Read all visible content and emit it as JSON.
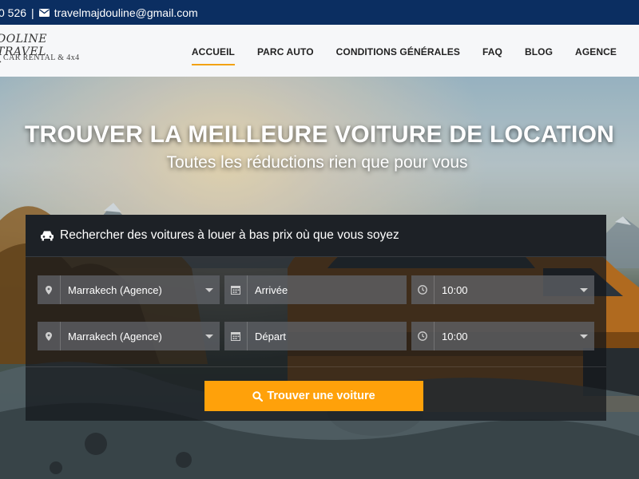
{
  "topbar": {
    "phone": "0 526",
    "separator": "|",
    "email": "travelmajdouline@gmail.com"
  },
  "logo": {
    "line1": "DOLINE TRAVEL",
    "line2": "CAR RENTAL & 4x4"
  },
  "nav": {
    "items": [
      {
        "label": "ACCUEIL",
        "active": true
      },
      {
        "label": "PARC AUTO"
      },
      {
        "label": "CONDITIONS GÉNÉRALES"
      },
      {
        "label": "FAQ"
      },
      {
        "label": "BLOG"
      },
      {
        "label": "AGENCE"
      }
    ]
  },
  "hero": {
    "title": "TROUVER LA MEILLEURE VOITURE DE LOCATION",
    "subtitle": "Toutes les réductions rien que pour vous"
  },
  "search": {
    "heading": "Rechercher des voitures à louer à bas prix où que vous soyez",
    "pickup_location": "Marrakech (Agence)",
    "pickup_date": "Arrivée",
    "pickup_time": "10:00",
    "return_location": "Marrakech (Agence)",
    "return_date": "Départ",
    "return_time": "10:00",
    "submit_label": "Trouver une voiture"
  },
  "colors": {
    "topbar": "#0b2e61",
    "accent": "#ffa10a"
  },
  "icons": {
    "mail": "envelope-icon",
    "car": "car-icon",
    "location": "map-pin-icon",
    "date": "calendar-icon",
    "time": "clock-icon",
    "search": "search-icon"
  }
}
